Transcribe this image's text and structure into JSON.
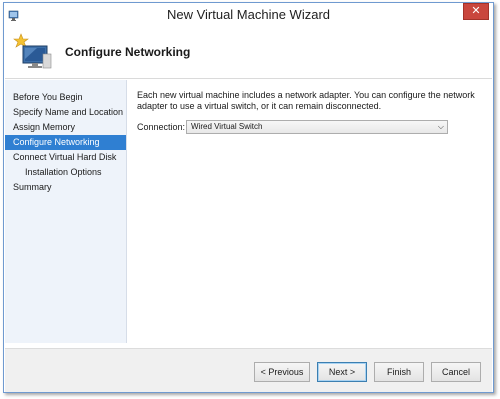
{
  "window": {
    "title": "New Virtual Machine Wizard",
    "close_label": "✕"
  },
  "header": {
    "title": "Configure Networking"
  },
  "sidebar": {
    "items": [
      {
        "label": "Before You Begin",
        "active": false,
        "indent": false
      },
      {
        "label": "Specify Name and Location",
        "active": false,
        "indent": false
      },
      {
        "label": "Assign Memory",
        "active": false,
        "indent": false
      },
      {
        "label": "Configure Networking",
        "active": true,
        "indent": false
      },
      {
        "label": "Connect Virtual Hard Disk",
        "active": false,
        "indent": false
      },
      {
        "label": "Installation Options",
        "active": false,
        "indent": true
      },
      {
        "label": "Summary",
        "active": false,
        "indent": false
      }
    ]
  },
  "main": {
    "description": "Each new virtual machine includes a network adapter. You can configure the network adapter to use a virtual switch, or it can remain disconnected.",
    "connection_label": "Connection:",
    "connection_value": "Wired Virtual Switch"
  },
  "footer": {
    "previous_label": "< Previous",
    "next_label": "Next >",
    "finish_label": "Finish",
    "cancel_label": "Cancel"
  },
  "colors": {
    "accent": "#2f7fd2",
    "sidebar_bg": "#eef3fa",
    "close_red": "#c9463d"
  }
}
